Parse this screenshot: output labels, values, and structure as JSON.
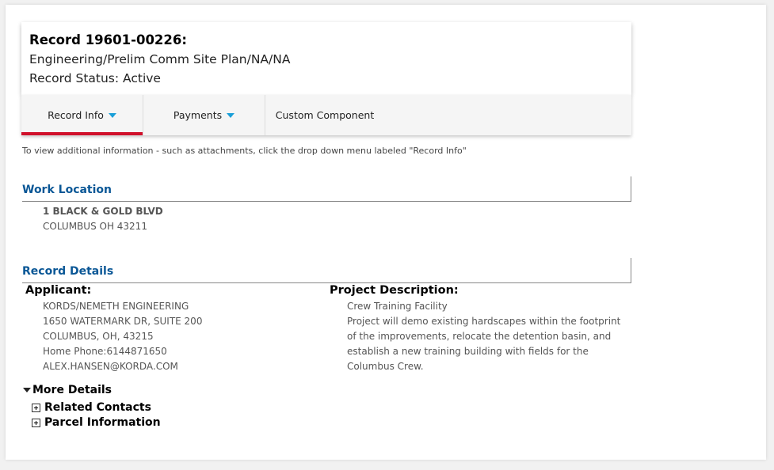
{
  "record": {
    "title": "Record 19601-00226:",
    "type": "Engineering/Prelim Comm Site Plan/NA/NA",
    "status": "Record Status: Active"
  },
  "tabs": [
    {
      "label": "Record Info",
      "has_dropdown": true,
      "active": true
    },
    {
      "label": "Payments",
      "has_dropdown": true,
      "active": false
    },
    {
      "label": "Custom Component",
      "has_dropdown": false,
      "active": false
    }
  ],
  "info_note": "To view additional information - such as attachments, click the drop down menu labeled \"Record Info\"",
  "work_location": {
    "heading": "Work Location",
    "line1": "1 BLACK & GOLD BLVD",
    "line2": "COLUMBUS OH 43211"
  },
  "record_details": {
    "heading": "Record Details",
    "applicant_label": "Applicant:",
    "applicant_lines": [
      "KORDS/NEMETH ENGINEERING",
      "1650 WATERMARK DR, SUITE 200",
      "COLUMBUS, OH, 43215",
      "Home Phone:6144871650",
      "ALEX.HANSEN@KORDA.COM"
    ],
    "project_label": "Project Description:",
    "project_name": "Crew Training Facility",
    "project_description": "Project will demo existing hardscapes within the footprint of the improvements, relocate the detention basin, and establish a new training building with fields for the Columbus Crew."
  },
  "more_details": {
    "label": "More Details",
    "items": [
      {
        "label": "Related Contacts"
      },
      {
        "label": "Parcel Information"
      }
    ]
  },
  "colors": {
    "accent_red": "#d0102a",
    "heading_blue": "#0a5796",
    "caret_blue": "#1a9fd8"
  }
}
